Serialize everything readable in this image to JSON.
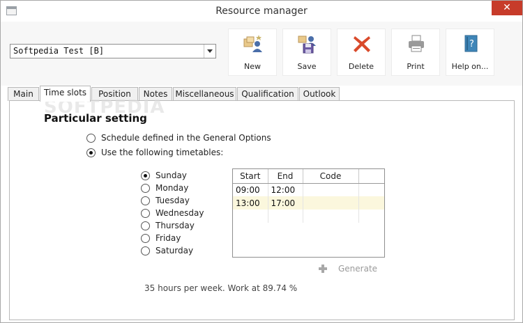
{
  "window": {
    "title": "Resource manager",
    "close_glyph": "✕"
  },
  "resource_select": {
    "value": "Softpedia Test [B]"
  },
  "toolbar": {
    "buttons": [
      {
        "label": "New",
        "icon": "new-user-icon"
      },
      {
        "label": "Save",
        "icon": "save-icon"
      },
      {
        "label": "Delete",
        "icon": "delete-icon"
      },
      {
        "label": "Print",
        "icon": "print-icon"
      },
      {
        "label": "Help on...",
        "icon": "help-book-icon"
      }
    ]
  },
  "tabs": [
    "Main",
    "Time slots",
    "Position",
    "Notes",
    "Miscellaneous",
    "Qualification",
    "Outlook"
  ],
  "watermark": "SOFTPEDIA",
  "panel": {
    "title": "Particular setting",
    "options": [
      {
        "label": "Schedule defined in the General Options",
        "checked": false
      },
      {
        "label": "Use the following timetables:",
        "checked": true
      }
    ],
    "days": [
      {
        "label": "Sunday",
        "checked": true
      },
      {
        "label": "Monday",
        "checked": false
      },
      {
        "label": "Tuesday",
        "checked": false
      },
      {
        "label": "Wednesday",
        "checked": false
      },
      {
        "label": "Thursday",
        "checked": false
      },
      {
        "label": "Friday",
        "checked": false
      },
      {
        "label": "Saturday",
        "checked": false
      }
    ],
    "table": {
      "columns": [
        "Start",
        "End",
        "Code"
      ],
      "rows": [
        {
          "start": "09:00",
          "end": "12:00",
          "code": ""
        },
        {
          "start": "13:00",
          "end": "17:00",
          "code": ""
        }
      ]
    },
    "generate_label": "Generate",
    "summary": "35 hours per week. Work at 89.74 %"
  },
  "colors": {
    "close": "#c73b2a",
    "selected_row": "#fbf7dd",
    "delete": "#d94a2b"
  }
}
